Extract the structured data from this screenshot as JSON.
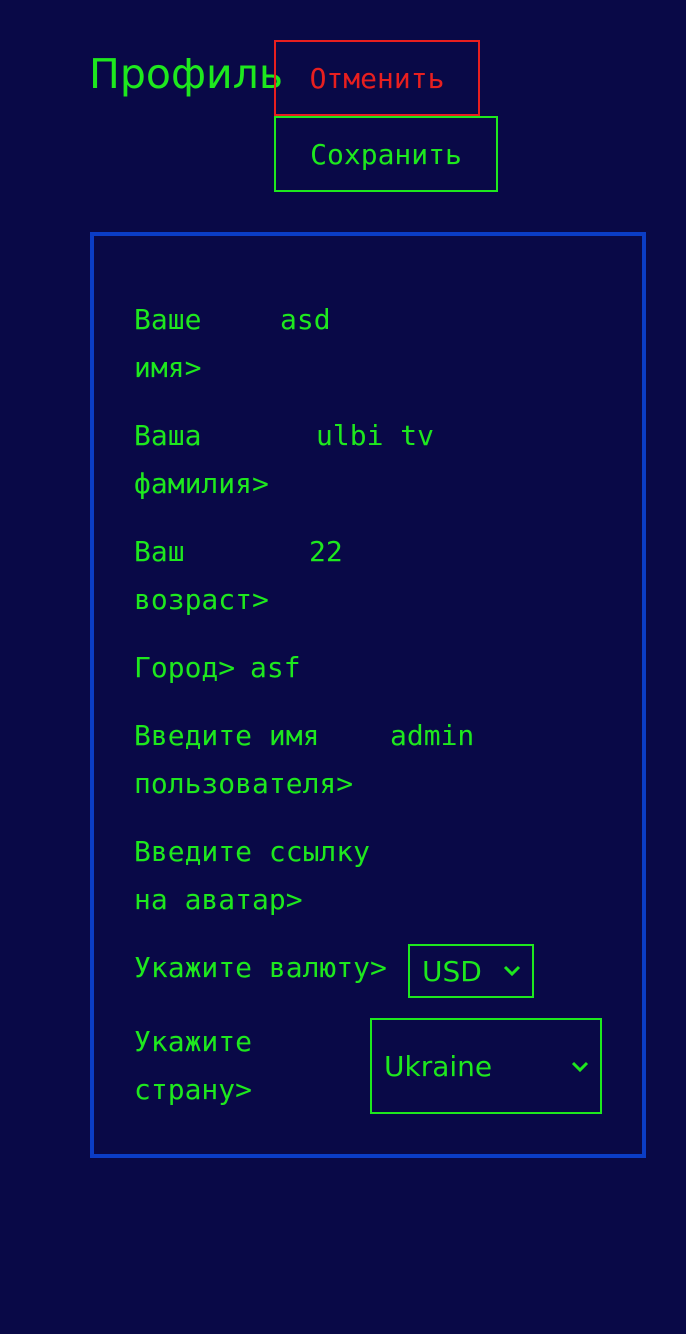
{
  "header": {
    "title": "Профиль",
    "cancel_label": "Отменить",
    "save_label": "Сохранить"
  },
  "form": {
    "first_name": {
      "label": "Ваше\nимя>",
      "value": "asd"
    },
    "last_name": {
      "label": "Ваша\nфамилия>",
      "value": "ulbi tv"
    },
    "age": {
      "label": "Ваш\nвозраст>",
      "value": "22"
    },
    "city": {
      "label": "Город>",
      "value": "asf"
    },
    "username": {
      "label": "Введите имя\nпользователя>",
      "value": "admin"
    },
    "avatar": {
      "label": "Введите ссылку\nна аватар>",
      "value": ""
    },
    "currency": {
      "label": "Укажите валюту>",
      "selected": "USD"
    },
    "country": {
      "label": "Укажите\nстрану>",
      "selected": "Ukraine"
    }
  },
  "colors": {
    "background": "#090947",
    "text": "#1ee81e",
    "cancel": "#e81f1f",
    "card_border": "#0b3dc6"
  },
  "icons": {
    "select_chevron": "chevron-down-icon"
  }
}
